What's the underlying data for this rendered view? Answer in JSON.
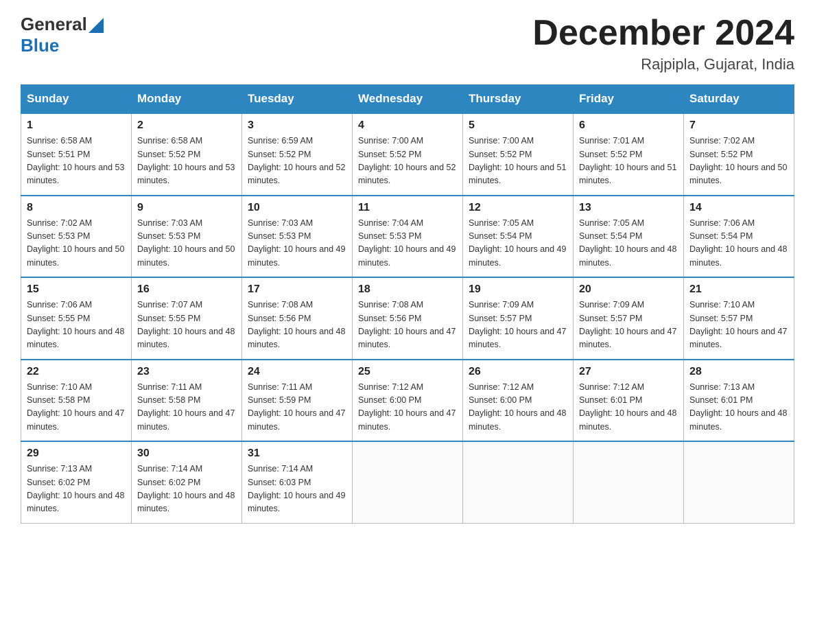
{
  "header": {
    "logo": {
      "general": "General",
      "blue": "Blue"
    },
    "month": "December 2024",
    "location": "Rajpipla, Gujarat, India"
  },
  "days_of_week": [
    "Sunday",
    "Monday",
    "Tuesday",
    "Wednesday",
    "Thursday",
    "Friday",
    "Saturday"
  ],
  "weeks": [
    [
      {
        "day": "1",
        "sunrise": "Sunrise: 6:58 AM",
        "sunset": "Sunset: 5:51 PM",
        "daylight": "Daylight: 10 hours and 53 minutes."
      },
      {
        "day": "2",
        "sunrise": "Sunrise: 6:58 AM",
        "sunset": "Sunset: 5:52 PM",
        "daylight": "Daylight: 10 hours and 53 minutes."
      },
      {
        "day": "3",
        "sunrise": "Sunrise: 6:59 AM",
        "sunset": "Sunset: 5:52 PM",
        "daylight": "Daylight: 10 hours and 52 minutes."
      },
      {
        "day": "4",
        "sunrise": "Sunrise: 7:00 AM",
        "sunset": "Sunset: 5:52 PM",
        "daylight": "Daylight: 10 hours and 52 minutes."
      },
      {
        "day": "5",
        "sunrise": "Sunrise: 7:00 AM",
        "sunset": "Sunset: 5:52 PM",
        "daylight": "Daylight: 10 hours and 51 minutes."
      },
      {
        "day": "6",
        "sunrise": "Sunrise: 7:01 AM",
        "sunset": "Sunset: 5:52 PM",
        "daylight": "Daylight: 10 hours and 51 minutes."
      },
      {
        "day": "7",
        "sunrise": "Sunrise: 7:02 AM",
        "sunset": "Sunset: 5:52 PM",
        "daylight": "Daylight: 10 hours and 50 minutes."
      }
    ],
    [
      {
        "day": "8",
        "sunrise": "Sunrise: 7:02 AM",
        "sunset": "Sunset: 5:53 PM",
        "daylight": "Daylight: 10 hours and 50 minutes."
      },
      {
        "day": "9",
        "sunrise": "Sunrise: 7:03 AM",
        "sunset": "Sunset: 5:53 PM",
        "daylight": "Daylight: 10 hours and 50 minutes."
      },
      {
        "day": "10",
        "sunrise": "Sunrise: 7:03 AM",
        "sunset": "Sunset: 5:53 PM",
        "daylight": "Daylight: 10 hours and 49 minutes."
      },
      {
        "day": "11",
        "sunrise": "Sunrise: 7:04 AM",
        "sunset": "Sunset: 5:53 PM",
        "daylight": "Daylight: 10 hours and 49 minutes."
      },
      {
        "day": "12",
        "sunrise": "Sunrise: 7:05 AM",
        "sunset": "Sunset: 5:54 PM",
        "daylight": "Daylight: 10 hours and 49 minutes."
      },
      {
        "day": "13",
        "sunrise": "Sunrise: 7:05 AM",
        "sunset": "Sunset: 5:54 PM",
        "daylight": "Daylight: 10 hours and 48 minutes."
      },
      {
        "day": "14",
        "sunrise": "Sunrise: 7:06 AM",
        "sunset": "Sunset: 5:54 PM",
        "daylight": "Daylight: 10 hours and 48 minutes."
      }
    ],
    [
      {
        "day": "15",
        "sunrise": "Sunrise: 7:06 AM",
        "sunset": "Sunset: 5:55 PM",
        "daylight": "Daylight: 10 hours and 48 minutes."
      },
      {
        "day": "16",
        "sunrise": "Sunrise: 7:07 AM",
        "sunset": "Sunset: 5:55 PM",
        "daylight": "Daylight: 10 hours and 48 minutes."
      },
      {
        "day": "17",
        "sunrise": "Sunrise: 7:08 AM",
        "sunset": "Sunset: 5:56 PM",
        "daylight": "Daylight: 10 hours and 48 minutes."
      },
      {
        "day": "18",
        "sunrise": "Sunrise: 7:08 AM",
        "sunset": "Sunset: 5:56 PM",
        "daylight": "Daylight: 10 hours and 47 minutes."
      },
      {
        "day": "19",
        "sunrise": "Sunrise: 7:09 AM",
        "sunset": "Sunset: 5:57 PM",
        "daylight": "Daylight: 10 hours and 47 minutes."
      },
      {
        "day": "20",
        "sunrise": "Sunrise: 7:09 AM",
        "sunset": "Sunset: 5:57 PM",
        "daylight": "Daylight: 10 hours and 47 minutes."
      },
      {
        "day": "21",
        "sunrise": "Sunrise: 7:10 AM",
        "sunset": "Sunset: 5:57 PM",
        "daylight": "Daylight: 10 hours and 47 minutes."
      }
    ],
    [
      {
        "day": "22",
        "sunrise": "Sunrise: 7:10 AM",
        "sunset": "Sunset: 5:58 PM",
        "daylight": "Daylight: 10 hours and 47 minutes."
      },
      {
        "day": "23",
        "sunrise": "Sunrise: 7:11 AM",
        "sunset": "Sunset: 5:58 PM",
        "daylight": "Daylight: 10 hours and 47 minutes."
      },
      {
        "day": "24",
        "sunrise": "Sunrise: 7:11 AM",
        "sunset": "Sunset: 5:59 PM",
        "daylight": "Daylight: 10 hours and 47 minutes."
      },
      {
        "day": "25",
        "sunrise": "Sunrise: 7:12 AM",
        "sunset": "Sunset: 6:00 PM",
        "daylight": "Daylight: 10 hours and 47 minutes."
      },
      {
        "day": "26",
        "sunrise": "Sunrise: 7:12 AM",
        "sunset": "Sunset: 6:00 PM",
        "daylight": "Daylight: 10 hours and 48 minutes."
      },
      {
        "day": "27",
        "sunrise": "Sunrise: 7:12 AM",
        "sunset": "Sunset: 6:01 PM",
        "daylight": "Daylight: 10 hours and 48 minutes."
      },
      {
        "day": "28",
        "sunrise": "Sunrise: 7:13 AM",
        "sunset": "Sunset: 6:01 PM",
        "daylight": "Daylight: 10 hours and 48 minutes."
      }
    ],
    [
      {
        "day": "29",
        "sunrise": "Sunrise: 7:13 AM",
        "sunset": "Sunset: 6:02 PM",
        "daylight": "Daylight: 10 hours and 48 minutes."
      },
      {
        "day": "30",
        "sunrise": "Sunrise: 7:14 AM",
        "sunset": "Sunset: 6:02 PM",
        "daylight": "Daylight: 10 hours and 48 minutes."
      },
      {
        "day": "31",
        "sunrise": "Sunrise: 7:14 AM",
        "sunset": "Sunset: 6:03 PM",
        "daylight": "Daylight: 10 hours and 49 minutes."
      },
      null,
      null,
      null,
      null
    ]
  ]
}
